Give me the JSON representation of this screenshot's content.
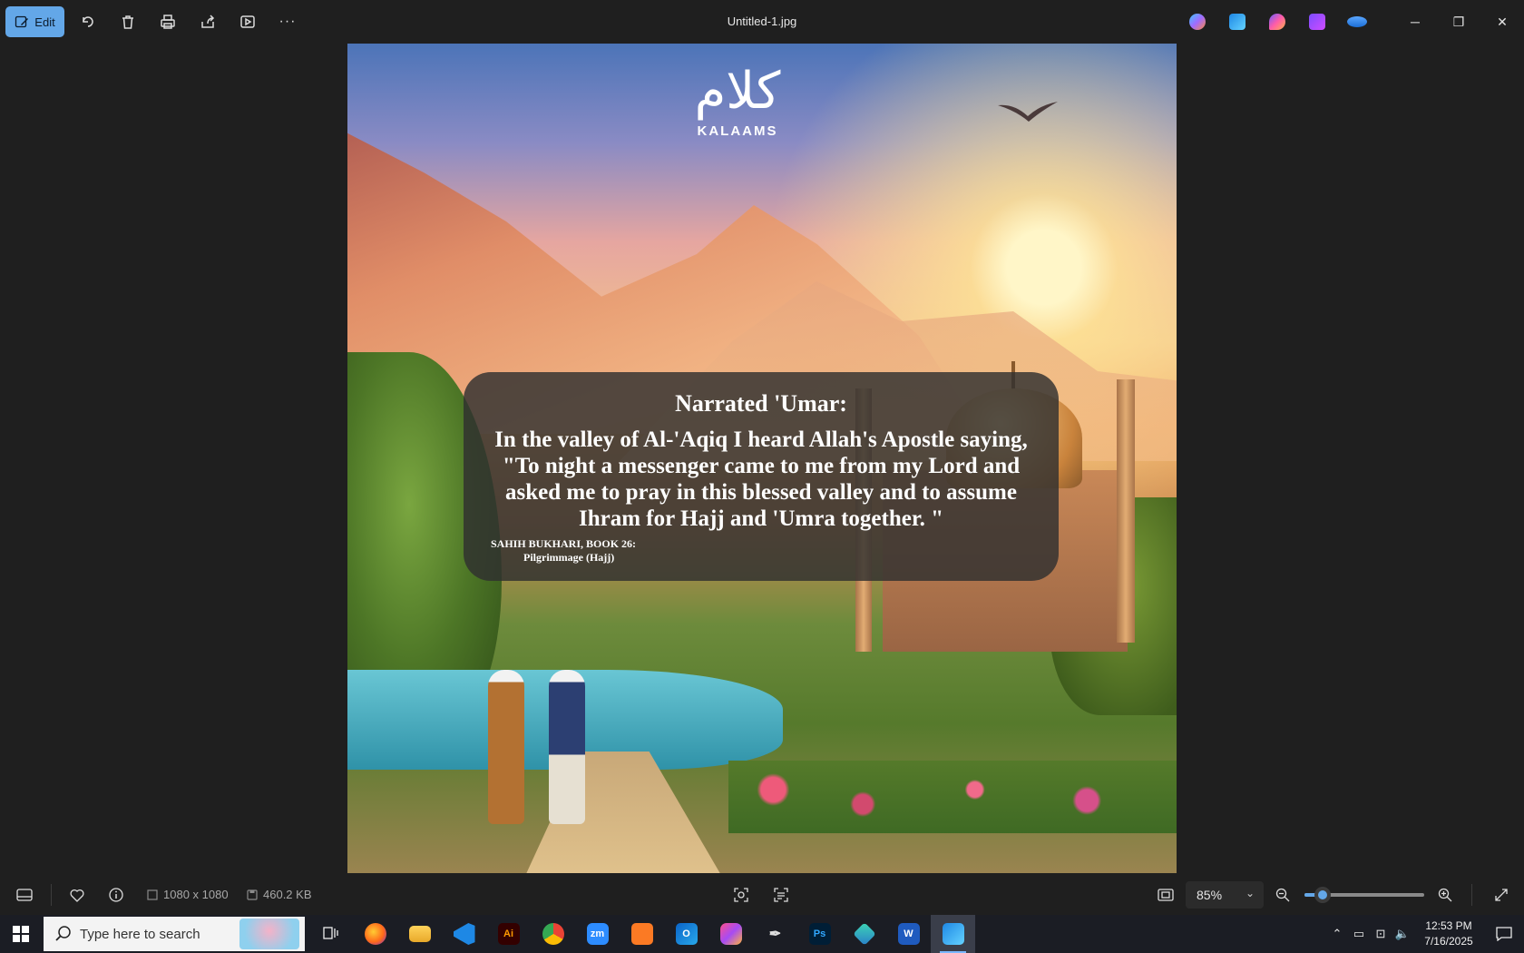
{
  "titlebar": {
    "edit_label": "Edit",
    "file_title": "Untitled-1.jpg",
    "more_label": "···",
    "minimize": "─",
    "restore": "❐",
    "close": "✕"
  },
  "photo": {
    "logo_text": "KALAAMS",
    "logo_mark": "كلام",
    "quote_title": "Narrated 'Umar:",
    "quote_body": "In the valley of Al-'Aqiq I heard Allah's Apostle saying, \"To night a messenger came to me from my Lord and asked me to pray in this blessed valley and to assume Ihram for Hajj and 'Umra together. \"",
    "source_line1": "SAHIH BUKHARI, BOOK 26:",
    "source_line2": "Pilgrimmage (Hajj)"
  },
  "bottombar": {
    "dimensions": "1080 x 1080",
    "file_size": "460.2 KB",
    "zoom_value": "85%",
    "zoom_fraction": 0.15
  },
  "taskbar": {
    "search_placeholder": "Type here to search",
    "time": "12:53 PM",
    "date": "7/16/2025",
    "apps": [
      {
        "name": "task-view",
        "label": ""
      },
      {
        "name": "firefox",
        "label": ""
      },
      {
        "name": "file-explorer",
        "label": ""
      },
      {
        "name": "vscode",
        "label": ""
      },
      {
        "name": "illustrator",
        "label": "Ai"
      },
      {
        "name": "chrome",
        "label": ""
      },
      {
        "name": "zoom",
        "label": "zm"
      },
      {
        "name": "xampp",
        "label": ""
      },
      {
        "name": "outlook",
        "label": ""
      },
      {
        "name": "creative-cloud",
        "label": ""
      },
      {
        "name": "pen-tool",
        "label": ""
      },
      {
        "name": "photoshop",
        "label": "Ps"
      },
      {
        "name": "app-diamond",
        "label": ""
      },
      {
        "name": "word",
        "label": "W"
      },
      {
        "name": "photos",
        "label": ""
      }
    ]
  },
  "colors": {
    "accent": "#63a7e8",
    "app_bg": "#1f1f1f",
    "taskbar_bg": "#1b1d24"
  }
}
